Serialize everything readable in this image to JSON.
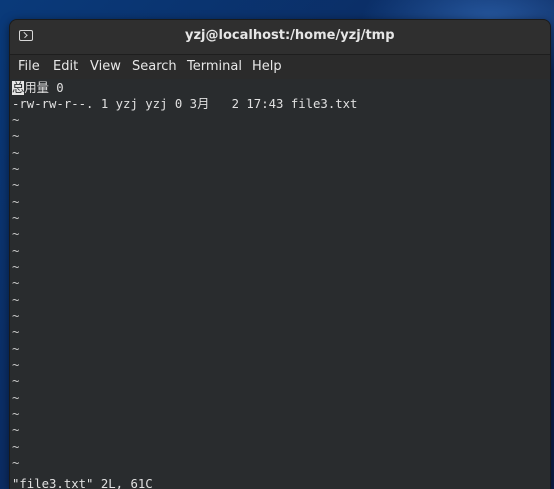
{
  "window": {
    "title": "yzj@localhost:/home/yzj/tmp"
  },
  "menubar": {
    "items": [
      "File",
      "Edit",
      "View",
      "Search",
      "Terminal",
      "Help"
    ]
  },
  "terminal": {
    "cursor_char": "总",
    "line1_rest": "用量 0",
    "line2": "-rw-rw-r--. 1 yzj yzj 0 3月   2 17:43 file3.txt",
    "tilde": "~",
    "status": "\"file3.txt\" 2L, 61C"
  },
  "colors": {
    "terminal_bg": "#292c2e",
    "titlebar_bg": "#2f2f2f",
    "text": "#e0e0e0"
  },
  "icons": {
    "window_icon": "terminal-icon"
  }
}
